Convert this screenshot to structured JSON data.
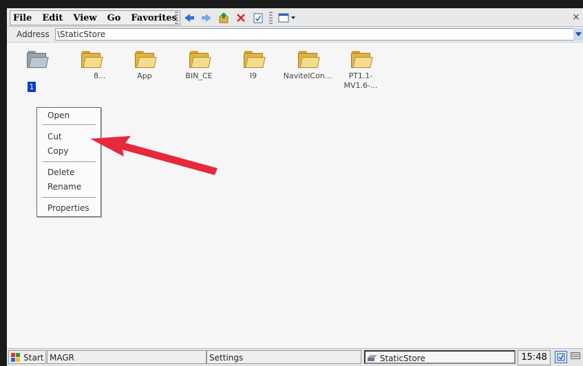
{
  "menu": [
    "File",
    "Edit",
    "View",
    "Go",
    "Favorites"
  ],
  "toolbar_icons": [
    "back-arrow-icon",
    "forward-arrow-icon",
    "up-folder-icon",
    "delete-x-icon",
    "properties-icon",
    "view-menu-icon"
  ],
  "close_glyph": "×",
  "address": {
    "label": "Address",
    "value": "\\StaticStore"
  },
  "items": [
    {
      "label": "1",
      "selected": true
    },
    {
      "label": "8..."
    },
    {
      "label": "App"
    },
    {
      "label": "BIN_CE"
    },
    {
      "label": "I9"
    },
    {
      "label": "NavitelCon..."
    },
    {
      "label_line1": "PT1.1-",
      "label_line2": "MV1.6-..."
    }
  ],
  "context_menu": {
    "open": "Open",
    "cut": "Cut",
    "copy": "Copy",
    "delete": "Delete",
    "rename": "Rename",
    "properties": "Properties"
  },
  "annotation": {
    "arrow_color": "#e8283c"
  },
  "taskbar": {
    "start": "Start",
    "window1": "MAGR",
    "window2": "Settings",
    "window3": "StaticStore",
    "clock": "15:48"
  }
}
